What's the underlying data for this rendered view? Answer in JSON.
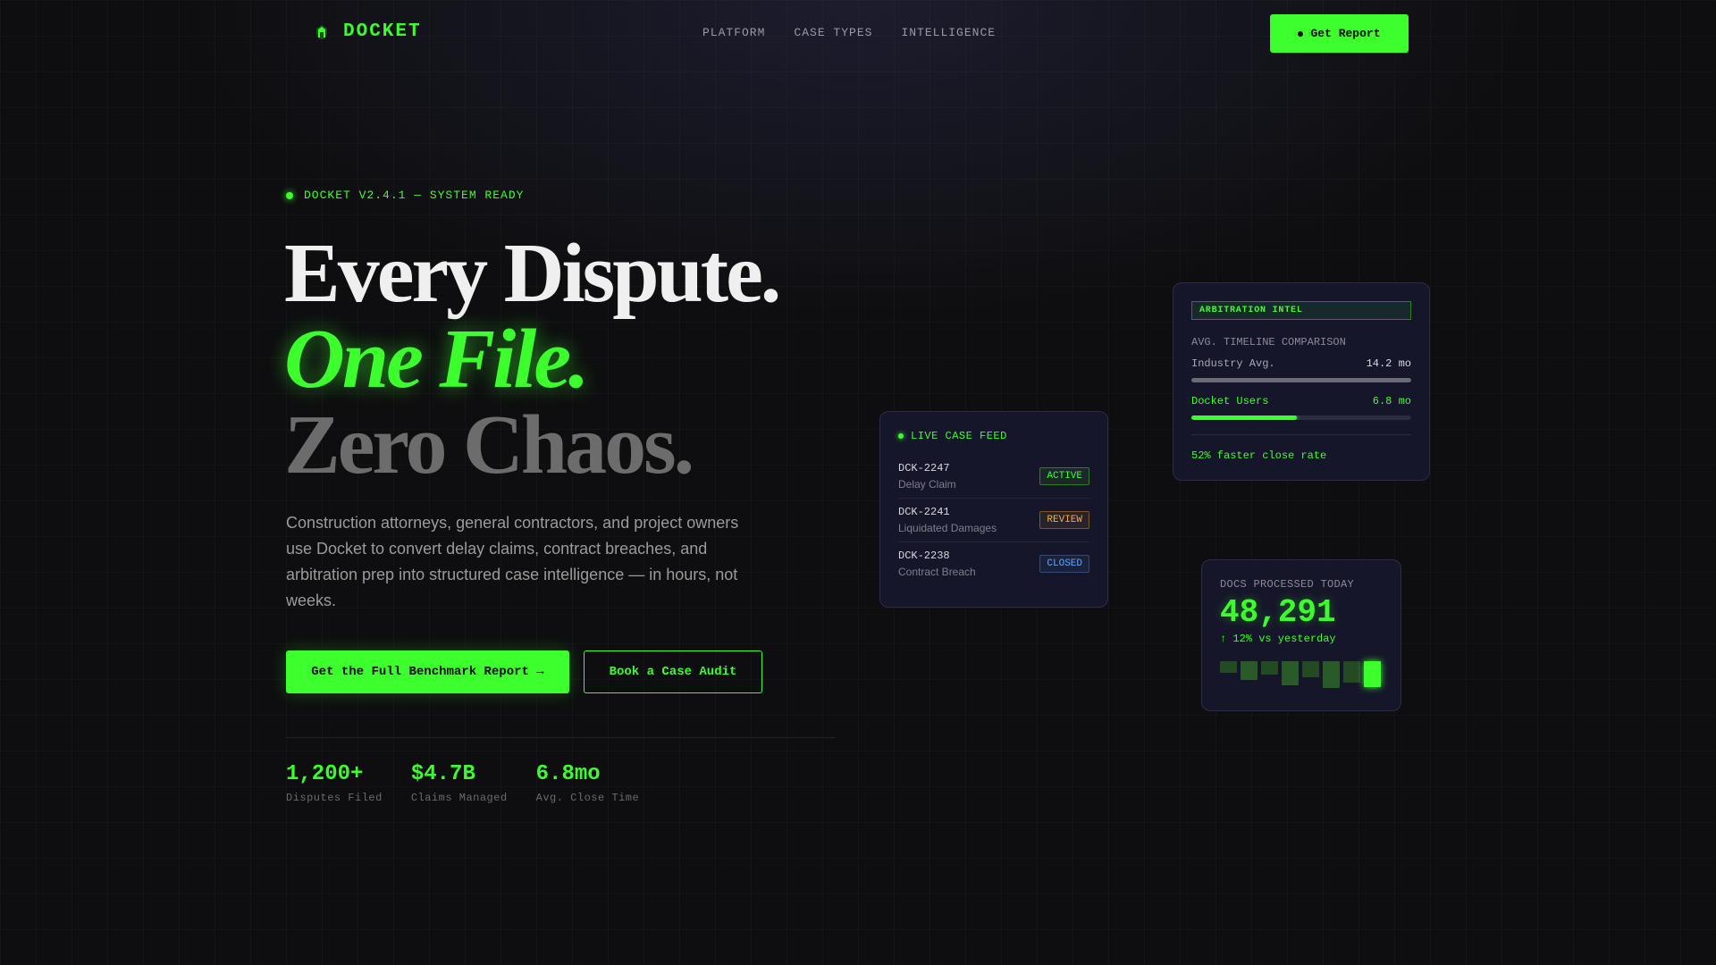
{
  "nav": {
    "logo_text": "DOCKET",
    "links": [
      "PLATFORM",
      "CASE TYPES",
      "INTELLIGENCE"
    ],
    "cta_label": "Get Report"
  },
  "hero": {
    "status": "DOCKET V2.4.1 — SYSTEM READY",
    "line1": "Every Dispute.",
    "line2": "One File.",
    "line3": "Zero Chaos.",
    "description": "Construction attorneys, general contractors, and project owners use Docket to convert delay claims, contract breaches, and arbitration prep into structured case intelligence — in hours, not weeks.",
    "primary_cta": "Get the Full Benchmark Report →",
    "secondary_cta": "Book a Case Audit",
    "stats": [
      {
        "value": "1,200+",
        "label": "Disputes Filed"
      },
      {
        "value": "$4.7B",
        "label": "Claims Managed"
      },
      {
        "value": "6.8mo",
        "label": "Avg. Close Time"
      }
    ]
  },
  "feed": {
    "title": "LIVE CASE FEED",
    "cases": [
      {
        "id": "DCK-2247",
        "type": "Delay Claim",
        "status": "ACTIVE"
      },
      {
        "id": "DCK-2241",
        "type": "Liquidated Damages",
        "status": "REVIEW"
      },
      {
        "id": "DCK-2238",
        "type": "Contract Breach",
        "status": "CLOSED"
      }
    ]
  },
  "intel": {
    "tag": "ARBITRATION INTEL",
    "subtitle": "AVG. TIMELINE COMPARISON",
    "industry_label": "Industry Avg.",
    "industry_value": "14.2 mo",
    "industry_fill": 1.0,
    "docket_label": "Docket Users",
    "docket_value": "6.8 mo",
    "docket_fill": 0.48,
    "footer": "52% faster close rate"
  },
  "docs": {
    "label": "DOCS PROCESSED TODAY",
    "value": "48,291",
    "delta": "↑ 12% vs yesterday",
    "spark_levels": [
      0.3,
      0.5,
      0.35,
      0.65,
      0.42,
      0.72,
      0.58,
      0.7
    ]
  },
  "colors": {
    "accent": "#3dff2e",
    "background": "#0e0e10",
    "card": "#16162a",
    "review": "#f3b13c",
    "closed": "#5ea6ff"
  },
  "icons": {
    "logo": "shield-icon"
  }
}
